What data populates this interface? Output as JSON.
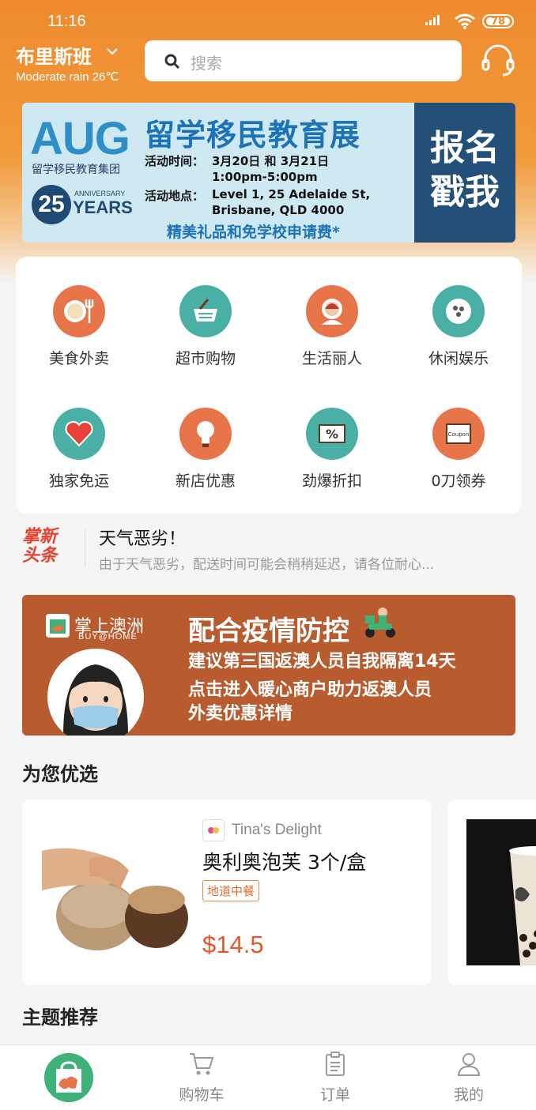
{
  "status": {
    "time": "11:16",
    "battery": "78"
  },
  "header": {
    "city": "布里斯班",
    "weather": "Moderate rain 26℃",
    "search_placeholder": "搜索"
  },
  "banner_expo": {
    "brand": "AUG",
    "brand_sub": "留学移民教育集团",
    "years_number": "25",
    "anniversary": "ANNIVERSARY",
    "years": "YEARS",
    "title": "留学移民教育展",
    "time_label": "活动时间：",
    "time_value_1": "3月20日 和 3月21日",
    "time_value_2": "1:00pm-5:00pm",
    "place_label": "活动地点：",
    "place_value_1": "Level 1, 25 Adelaide St,",
    "place_value_2": "Brisbane, QLD 4000",
    "footer": "精美礼品和免学校申请费*",
    "cta_1": "报名",
    "cta_2": "戳我"
  },
  "categories": [
    {
      "label": "美食外卖",
      "icon": "food-icon",
      "color": "#e8744a"
    },
    {
      "label": "超市购物",
      "icon": "basket-icon",
      "color": "#4ab0a5"
    },
    {
      "label": "生活丽人",
      "icon": "woman-icon",
      "color": "#e8744a"
    },
    {
      "label": "休闲娱乐",
      "icon": "bowling-icon",
      "color": "#4ab0a5"
    },
    {
      "label": "独家免运",
      "icon": "heart-icon",
      "color": "#4ab0a5"
    },
    {
      "label": "新店优惠",
      "icon": "lightbulb-icon",
      "color": "#e8744a"
    },
    {
      "label": "劲爆折扣",
      "icon": "percent-icon",
      "color": "#4ab0a5"
    },
    {
      "label": "0刀领券",
      "icon": "coupon-icon",
      "color": "#e8744a",
      "icon_text": "Coupon"
    }
  ],
  "news": {
    "logo_1": "掌新",
    "logo_2": "头条",
    "title": "天气恶劣！",
    "body": "由于天气恶劣，配送时间可能会稍稍延迟，请各位耐心..."
  },
  "banner_covid": {
    "brand": "掌上澳洲",
    "brand_sub": "BUY@HOME",
    "title": "配合疫情防控",
    "line1": "建议第三国返澳人员自我隔离14天",
    "line2": "点击进入暖心商户助力返澳人员",
    "line3": "外卖优惠详情"
  },
  "recommend": {
    "title": "为您优选",
    "products": [
      {
        "shop": "Tina's Delight",
        "name": "奥利奥泡芙 3个/盒",
        "tag": "地道中餐",
        "price": "$14.5"
      }
    ]
  },
  "theme": {
    "title": "主题推荐"
  },
  "tabbar": {
    "cart": "购物车",
    "orders": "订单",
    "me": "我的"
  }
}
